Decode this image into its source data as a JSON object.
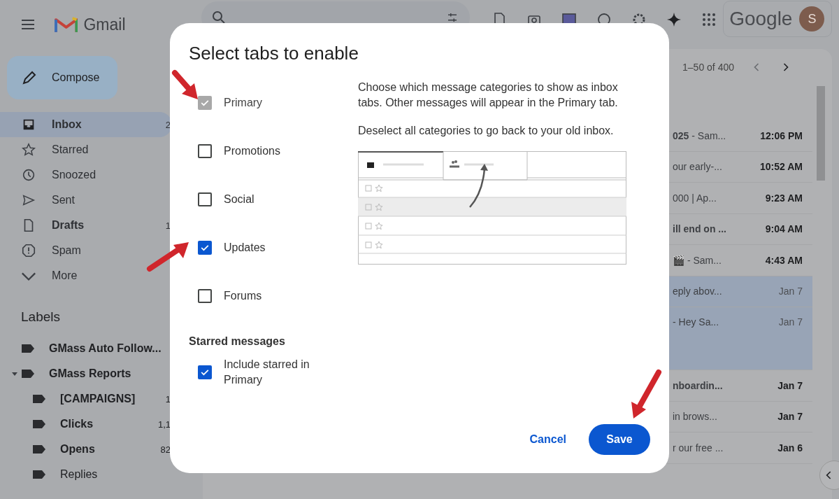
{
  "app": {
    "title": "Gmail"
  },
  "header": {
    "account_logo": "Google",
    "avatar": "S"
  },
  "sidebar": {
    "compose": "Compose",
    "nav": [
      {
        "label": "Inbox",
        "count": "2",
        "selected": true,
        "bold": true
      },
      {
        "label": "Starred",
        "selected": false,
        "bold": false
      },
      {
        "label": "Snoozed",
        "selected": false,
        "bold": false
      },
      {
        "label": "Sent",
        "selected": false,
        "bold": false
      },
      {
        "label": "Drafts",
        "count": "1",
        "selected": false,
        "bold": true
      },
      {
        "label": "Spam",
        "selected": false,
        "bold": false
      },
      {
        "label": "More",
        "selected": false,
        "bold": false
      }
    ],
    "labels_heading": "Labels",
    "labels": [
      {
        "name": "GMass Auto Follow...",
        "bold": true
      },
      {
        "name": "GMass Reports",
        "bold": true,
        "expanded": true,
        "children": [
          {
            "name": "[CAMPAIGNS]",
            "count": "1",
            "bold": true
          },
          {
            "name": "Clicks",
            "count": "1,1",
            "bold": true
          },
          {
            "name": "Opens",
            "count": "82",
            "bold": true
          },
          {
            "name": "Replies",
            "bold": false
          }
        ]
      }
    ]
  },
  "mail": {
    "pagination": "1–50 of 400",
    "rows": [
      {
        "snippet": "**025** - Sam...",
        "time": "12:06 PM",
        "unread": true,
        "selected": false
      },
      {
        "snippet": "our early-...",
        "time": "10:52 AM",
        "unread": true,
        "selected": false
      },
      {
        "snippet": "000 | Ap...",
        "time": "9:23 AM",
        "unread": true,
        "selected": false
      },
      {
        "snippet": "**ill end on ...**",
        "time": "9:04 AM",
        "unread": true,
        "selected": false
      },
      {
        "snippet": "🎬 - Sam...",
        "time": "4:43 AM",
        "unread": true,
        "selected": false
      },
      {
        "snippet": "eply abov...",
        "time": "Jan 7",
        "unread": false,
        "selected": true
      },
      {
        "snippet": "- Hey Sa...",
        "time": "Jan 7",
        "unread": false,
        "selected": true
      },
      {
        "snippet": "**nboardin...**",
        "time": "Jan 7",
        "unread": true,
        "selected": false
      },
      {
        "snippet": "in brows...",
        "time": "Jan 7",
        "unread": true,
        "selected": false
      },
      {
        "snippet": "r our free ...",
        "time": "Jan 6",
        "unread": true,
        "selected": false
      }
    ]
  },
  "dialog": {
    "title": "Select tabs to enable",
    "categories": [
      {
        "label": "Primary",
        "checked": true,
        "disabled": true
      },
      {
        "label": "Promotions",
        "checked": false,
        "disabled": false
      },
      {
        "label": "Social",
        "checked": false,
        "disabled": false
      },
      {
        "label": "Updates",
        "checked": true,
        "disabled": false
      },
      {
        "label": "Forums",
        "checked": false,
        "disabled": false
      }
    ],
    "description": [
      "Choose which message categories to show as inbox tabs. Other messages will appear in the Primary tab.",
      "Deselect all categories to go back to your old inbox."
    ],
    "starred_heading": "Starred messages",
    "starred_option": {
      "label": "Include starred in Primary",
      "checked": true
    },
    "buttons": {
      "cancel": "Cancel",
      "save": "Save"
    }
  }
}
